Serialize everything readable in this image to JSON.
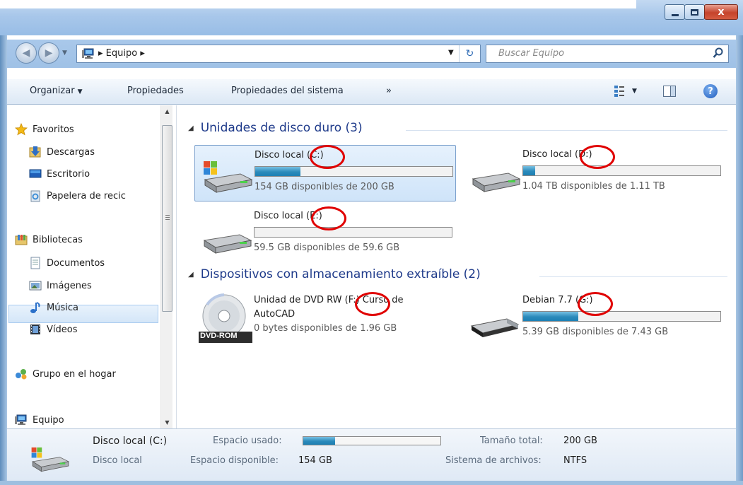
{
  "window": {
    "caption_buttons": {
      "minimize_icon": "minimize-icon",
      "maximize_icon": "maximize-icon",
      "close_icon": "close-icon",
      "close_glyph": "x"
    }
  },
  "address_bar": {
    "crumb_separator": "▸",
    "crumb": "Equipo",
    "search_placeholder": "Buscar Equipo"
  },
  "toolbar": {
    "organize": "Organizar",
    "properties": "Propiedades",
    "system_properties": "Propiedades del sistema",
    "more": "»"
  },
  "sidebar": {
    "favorites": {
      "label": "Favoritos",
      "items": [
        "Descargas",
        "Escritorio",
        "Papelera de recic"
      ]
    },
    "libraries": {
      "label": "Bibliotecas",
      "items": [
        "Documentos",
        "Imágenes",
        "Música",
        "Vídeos"
      ]
    },
    "homegroup": "Grupo en el hogar",
    "computer": "Equipo"
  },
  "groups": {
    "hard_drives": {
      "title": "Unidades de disco duro (3)",
      "drives": [
        {
          "name": "Disco local (C:)",
          "free_text": "154 GB disponibles de 200 GB",
          "used_fraction": 0.23,
          "selected": true
        },
        {
          "name": "Disco local (D:)",
          "free_text": "1.04 TB disponibles de 1.11 TB",
          "used_fraction": 0.06,
          "selected": false
        },
        {
          "name": "Disco local (E:)",
          "free_text": "59.5 GB disponibles de 59.6 GB",
          "used_fraction": 0.0,
          "selected": false
        }
      ]
    },
    "removable": {
      "title": "Dispositivos con almacenamiento extraíble (2)",
      "drives": [
        {
          "name_line1": "Unidad de DVD RW (F:) Curso de",
          "name_line2": "AutoCAD",
          "free_text": "0 bytes disponibles de 1.96 GB",
          "badge": "DVD-ROM"
        },
        {
          "name": "Debian 7.7 (G:)",
          "free_text": "5.39 GB disponibles de 7.43 GB",
          "used_fraction": 0.28
        }
      ]
    }
  },
  "details": {
    "name": "Disco local (C:)",
    "type": "Disco local",
    "used_label": "Espacio usado:",
    "used_fraction": 0.23,
    "free_label": "Espacio disponible:",
    "free_value": "154 GB",
    "total_label": "Tamaño total:",
    "total_value": "200 GB",
    "fs_label": "Sistema de archivos:",
    "fs_value": "NTFS"
  },
  "colors": {
    "highlight_circle": "#e00000",
    "group_title": "#1e3a8a",
    "usage_bar": "#2b8abb"
  }
}
